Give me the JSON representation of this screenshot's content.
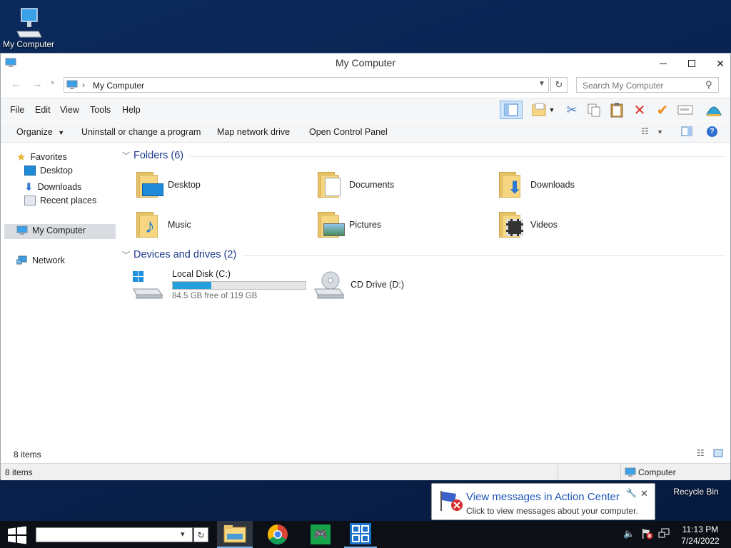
{
  "desktop": {
    "my_computer_label": "My Computer",
    "recycle_bin_label": "Recycle Bin"
  },
  "window": {
    "title": "My Computer",
    "address": {
      "path": "My Computer"
    },
    "search": {
      "placeholder": "Search My Computer"
    },
    "menu": [
      "File",
      "Edit",
      "View",
      "Tools",
      "Help"
    ],
    "commands": {
      "organize": "Organize",
      "uninstall": "Uninstall or change a program",
      "map_drive": "Map network drive",
      "control_panel": "Open Control Panel"
    },
    "nav": {
      "favorites": "Favorites",
      "desktop": "Desktop",
      "downloads": "Downloads",
      "recent": "Recent places",
      "computer": "My Computer",
      "network": "Network"
    },
    "folders_group": "Folders (6)",
    "folders": [
      "Desktop",
      "Documents",
      "Downloads",
      "Music",
      "Pictures",
      "Videos"
    ],
    "drives_group": "Devices and drives (2)",
    "drives": {
      "c_name": "Local Disk (C:)",
      "c_free": "84.5 GB free of 119 GB",
      "c_used_fraction": 0.29,
      "d_name": "CD Drive (D:)"
    },
    "item_count": "8 items",
    "statusbar": {
      "count": "8 items",
      "location": "Computer"
    }
  },
  "notification": {
    "title": "View messages in Action Center",
    "body": "Click to view messages about your computer."
  },
  "taskbar": {
    "time": "11:13 PM",
    "date": "7/24/2022"
  },
  "colors": {
    "accent": "#1e3a8a",
    "drive_bar": "#26a0da",
    "taskbar": "#0c0f16"
  }
}
